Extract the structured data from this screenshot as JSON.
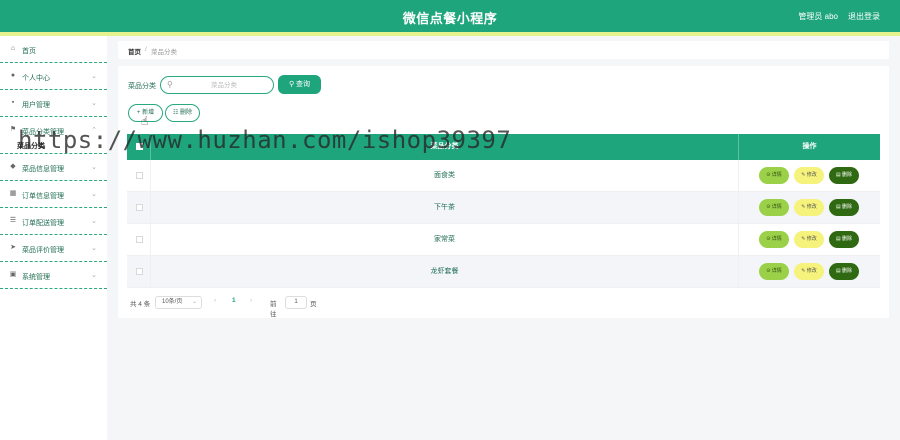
{
  "header": {
    "app_title": "微信点餐小程序",
    "admin_label": "管理员 abo",
    "logout_label": "退出登录"
  },
  "sidebar": {
    "items": [
      {
        "label": "首页",
        "icon": "home-icon"
      },
      {
        "label": "个人中心",
        "icon": "user-icon"
      },
      {
        "label": "用户管理",
        "icon": "users-icon"
      },
      {
        "label": "菜品分类管理",
        "icon": "flag-icon",
        "sub": "菜品分类"
      },
      {
        "label": "菜品信息管理",
        "icon": "dish-icon"
      },
      {
        "label": "订单信息管理",
        "icon": "order-icon"
      },
      {
        "label": "订单配送管理",
        "icon": "delivery-icon"
      },
      {
        "label": "菜品评价管理",
        "icon": "review-icon"
      },
      {
        "label": "系统管理",
        "icon": "settings-icon"
      }
    ]
  },
  "breadcrumb": {
    "home": "首页",
    "separator": "/",
    "current": "菜品分类"
  },
  "search": {
    "label": "菜品分类",
    "placeholder": "菜品分类",
    "button_label": "查询"
  },
  "toolbar": {
    "add_label": "+ 新增",
    "delete_label": "删除"
  },
  "table": {
    "columns": [
      "菜品分类",
      "操作"
    ],
    "rows": [
      {
        "name": "面食类"
      },
      {
        "name": "下午茶"
      },
      {
        "name": "家常菜"
      },
      {
        "name": "龙虾套餐"
      }
    ],
    "actions": {
      "detail": "详情",
      "edit": "修改",
      "delete": "删除"
    }
  },
  "pagination": {
    "total": "共 4 条",
    "page_size": "10条/页",
    "current_page": "1",
    "goto_label": "前往",
    "goto_value": "1",
    "page_unit": "页"
  },
  "watermark": "https://www.huzhan.com/ishop39397",
  "colors": {
    "primary": "#1ea57b",
    "accent_strip": "#e5f38e",
    "detail_button": "#9bd148",
    "edit_button": "#f5f37c",
    "delete_button": "#2f6a12"
  }
}
